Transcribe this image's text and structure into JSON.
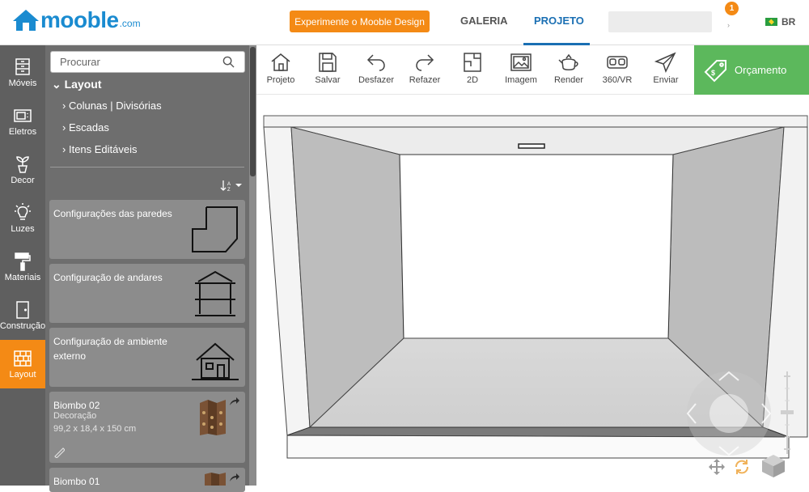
{
  "header": {
    "logo_word": "mooble",
    "logo_suffix": ".com",
    "cta_label": "Experimente o Mooble Design",
    "nav": [
      "GALERIA",
      "PROJETO"
    ],
    "notification_count": "1",
    "language": "BR"
  },
  "sidebar": {
    "items": [
      {
        "label": "Móveis",
        "icon": "cabinet-icon"
      },
      {
        "label": "Eletros",
        "icon": "microwave-icon"
      },
      {
        "label": "Decor",
        "icon": "plant-icon"
      },
      {
        "label": "Luzes",
        "icon": "bulb-icon"
      },
      {
        "label": "Materiais",
        "icon": "paint-roller-icon"
      },
      {
        "label": "Construção",
        "icon": "door-icon"
      },
      {
        "label": "Layout",
        "icon": "brick-wall-icon"
      }
    ],
    "active_item": "Layout"
  },
  "panel": {
    "search_placeholder": "Procurar",
    "tree_root": "Layout",
    "tree_items": [
      "Colunas | Divisórias",
      "Escadas",
      "Itens Editáveis"
    ],
    "cards": [
      {
        "title": "Configurações das paredes"
      },
      {
        "title": "Configuração de andares"
      },
      {
        "title": "Configuração de ambiente externo"
      },
      {
        "title": "Biombo 02",
        "category": "Decoração",
        "dimensions": "99,2 x 18,4 x 150 cm"
      },
      {
        "title": "Biombo 01"
      }
    ]
  },
  "toolbar": {
    "buttons": [
      "Projeto",
      "Salvar",
      "Desfazer",
      "Refazer",
      "2D",
      "Imagem",
      "Render",
      "360/VR",
      "Enviar"
    ],
    "budget_label": "Orçamento"
  },
  "colors": {
    "brand_blue": "#1a8bd0",
    "accent_orange": "#f48a15",
    "budget_green": "#5cb85c",
    "panel_grey": "#6e6e6e"
  }
}
